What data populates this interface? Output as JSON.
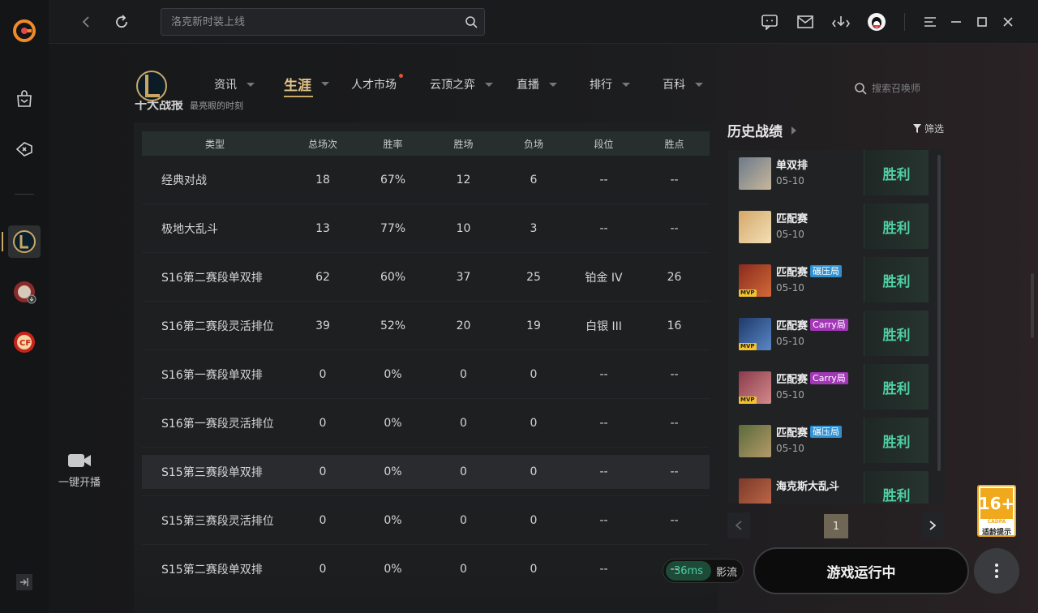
{
  "topbar": {
    "search_placeholder": "洛克新时装上线"
  },
  "nav": {
    "items": [
      {
        "label": "资讯",
        "has_caret": true
      },
      {
        "label": "生涯",
        "has_caret": true,
        "active": true
      },
      {
        "label": "人才市场",
        "has_dot": true
      },
      {
        "label": "云顶之弈",
        "has_caret": true
      },
      {
        "label": "直播",
        "has_caret": true
      },
      {
        "label": "排行",
        "has_caret": true
      },
      {
        "label": "百科",
        "has_caret": true
      }
    ],
    "search_placeholder": "搜索召唤师"
  },
  "section": {
    "title": "十大战报",
    "subtitle": "最亮眼的时刻"
  },
  "stats": {
    "columns": [
      "类型",
      "总场次",
      "胜率",
      "胜场",
      "负场",
      "段位",
      "胜点"
    ],
    "rows": [
      [
        "经典对战",
        "18",
        "67%",
        "12",
        "6",
        "--",
        "--"
      ],
      [
        "极地大乱斗",
        "13",
        "77%",
        "10",
        "3",
        "--",
        "--"
      ],
      [
        "S16第二赛段单双排",
        "62",
        "60%",
        "37",
        "25",
        "铂金 IV",
        "26"
      ],
      [
        "S16第二赛段灵活排位",
        "39",
        "52%",
        "20",
        "19",
        "白银 III",
        "16"
      ],
      [
        "S16第一赛段单双排",
        "0",
        "0%",
        "0",
        "0",
        "--",
        "--"
      ],
      [
        "S16第一赛段灵活排位",
        "0",
        "0%",
        "0",
        "0",
        "--",
        "--"
      ],
      [
        "S15第三赛段单双排",
        "0",
        "0%",
        "0",
        "0",
        "--",
        "--"
      ],
      [
        "S15第三赛段灵活排位",
        "0",
        "0%",
        "0",
        "0",
        "--",
        "--"
      ],
      [
        "S15第二赛段单双排",
        "0",
        "0%",
        "0",
        "0",
        "--",
        "--"
      ]
    ]
  },
  "history": {
    "title": "历史战绩",
    "filter_label": "筛选",
    "matches": [
      {
        "mode": "单双排",
        "date": "05-10",
        "result": "胜利",
        "tag": "",
        "mvp": false
      },
      {
        "mode": "匹配赛",
        "date": "05-10",
        "result": "胜利",
        "tag": "",
        "mvp": false
      },
      {
        "mode": "匹配赛",
        "date": "05-10",
        "result": "胜利",
        "tag": "碾压局",
        "tag_color": "blue",
        "mvp": true
      },
      {
        "mode": "匹配赛",
        "date": "05-10",
        "result": "胜利",
        "tag": "Carry局",
        "tag_color": "purple",
        "mvp": true
      },
      {
        "mode": "匹配赛",
        "date": "05-10",
        "result": "胜利",
        "tag": "Carry局",
        "tag_color": "purple",
        "mvp": true
      },
      {
        "mode": "匹配赛",
        "date": "05-10",
        "result": "胜利",
        "tag": "碾压局",
        "tag_color": "blue",
        "mvp": false
      },
      {
        "mode": "海克斯大乱斗",
        "date": "",
        "result": "胜利",
        "tag": "",
        "mvp": false
      }
    ],
    "mvp_label": "MVP",
    "page": "1"
  },
  "bottom": {
    "live_label": "一键开播",
    "ping_value": "36ms",
    "ping_label": "影流",
    "play_label": "游戏运行中"
  },
  "age_rating": {
    "number": "16+",
    "org": "CADPA",
    "label": "适龄提示"
  },
  "colors": {
    "accent_gold": "#c9a866",
    "win_green": "#4fcfa3",
    "tag_blue": "#2f8fd0",
    "tag_purple": "#a437b8"
  }
}
